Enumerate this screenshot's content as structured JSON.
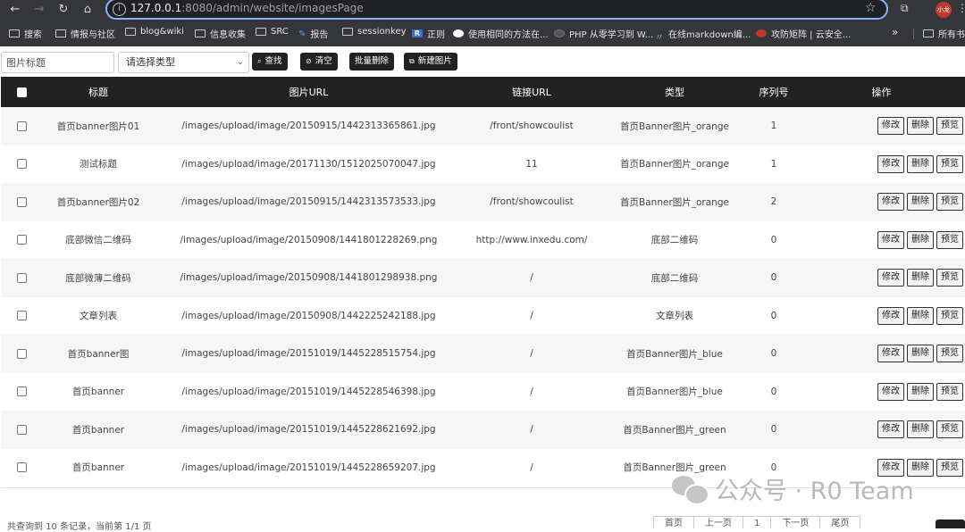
{
  "browser": {
    "url_host": "127.0.0.1",
    "url_path": ":8080/admin/website/imagesPage",
    "avatar_label": "小龙",
    "bookmarks": [
      {
        "label": "搜索",
        "icon": "folder-icon",
        "kind": ""
      },
      {
        "label": "情报与社区",
        "icon": "folder-icon",
        "kind": ""
      },
      {
        "label": "blog&wiki",
        "icon": "folder-icon",
        "kind": ""
      },
      {
        "label": "信息收集",
        "icon": "folder-icon",
        "kind": ""
      },
      {
        "label": "SRC",
        "icon": "folder-icon",
        "kind": ""
      },
      {
        "label": "报告",
        "icon": "bookmark-icon",
        "kind": "b"
      },
      {
        "label": "sessionkey",
        "icon": "folder-icon",
        "kind": ""
      },
      {
        "label": "正则",
        "icon": "regex-icon",
        "kind": "r"
      },
      {
        "label": "使用相同的方法在...",
        "icon": "medium-icon",
        "kind": "m"
      },
      {
        "label": "PHP 从零学习到 W...",
        "icon": "php-icon",
        "kind": "p"
      },
      {
        "label": "在线markdown编...",
        "icon": "markdown-icon",
        "kind": "u"
      },
      {
        "label": "攻防矩阵 | 云安全...",
        "icon": "shield-icon",
        "kind": "s"
      }
    ],
    "bookmarks_more": "»",
    "all_bookmarks": "所有书"
  },
  "toolbar": {
    "title_placeholder": "图片标题",
    "type_select": "请选择类型",
    "search_label": "查找",
    "clear_label": "清空",
    "batch_delete_label": "批量删除",
    "new_image_label": "新建图片"
  },
  "table": {
    "headers": {
      "title": "标题",
      "url": "图片URL",
      "link": "链接URL",
      "type": "类型",
      "seq": "序列号",
      "ops": "操作"
    },
    "action_labels": {
      "edit": "修改",
      "delete": "删除",
      "preview": "预览"
    },
    "rows": [
      {
        "title": "首页banner图片01",
        "url": "/images/upload/image/20150915/1442313365861.jpg",
        "link": "/front/showcoulist",
        "type": "首页Banner图片_orange",
        "seq": "1"
      },
      {
        "title": "测试标题",
        "url": "/images/upload/image/20171130/1512025070047.jpg",
        "link": "11",
        "type": "首页Banner图片_orange",
        "seq": "1"
      },
      {
        "title": "首页banner图片02",
        "url": "/images/upload/image/20150915/1442313573533.jpg",
        "link": "/front/showcoulist",
        "type": "首页Banner图片_orange",
        "seq": "2"
      },
      {
        "title": "底部微信二维码",
        "url": "/images/upload/image/20150908/1441801228269.png",
        "link": "http://www.inxedu.com/",
        "type": "底部二维码",
        "seq": "0"
      },
      {
        "title": "底部微薄二维码",
        "url": "/images/upload/image/20150908/1441801298938.png",
        "link": "/",
        "type": "底部二维码",
        "seq": "0"
      },
      {
        "title": "文章列表",
        "url": "/images/upload/image/20150908/1442225242188.jpg",
        "link": "/",
        "type": "文章列表",
        "seq": "0"
      },
      {
        "title": "首页banner图",
        "url": "/images/upload/image/20151019/1445228515754.jpg",
        "link": "/",
        "type": "首页Banner图片_blue",
        "seq": "0"
      },
      {
        "title": "首页banner",
        "url": "/images/upload/image/20151019/1445228546398.jpg",
        "link": "/",
        "type": "首页Banner图片_blue",
        "seq": "0"
      },
      {
        "title": "首页banner",
        "url": "/images/upload/image/20151019/1445228621692.jpg",
        "link": "/",
        "type": "首页Banner图片_green",
        "seq": "0"
      },
      {
        "title": "首页banner",
        "url": "/images/upload/image/20151019/1445228659207.jpg",
        "link": "/",
        "type": "首页Banner图片_green",
        "seq": "0"
      }
    ]
  },
  "footer": {
    "summary": "共查询到 10 条记录，当前第 1/1 页",
    "pager": [
      "首页",
      "上一页",
      "1",
      "下一页",
      "尾页"
    ]
  },
  "watermark": {
    "text": "公众号 · R0 Team"
  }
}
